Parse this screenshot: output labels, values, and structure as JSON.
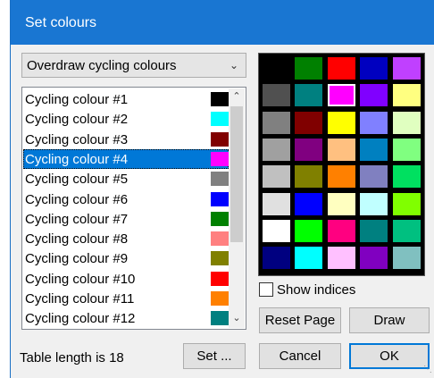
{
  "window": {
    "title": "Set colours"
  },
  "dropdown": {
    "value": "Overdraw cycling colours"
  },
  "list": {
    "items": [
      {
        "label": "Cycling colour #1",
        "color": "#000000"
      },
      {
        "label": "Cycling colour #2",
        "color": "#00ffff"
      },
      {
        "label": "Cycling colour #3",
        "color": "#800000"
      },
      {
        "label": "Cycling colour #4",
        "color": "#ff00ff",
        "selected": true
      },
      {
        "label": "Cycling colour #5",
        "color": "#808080"
      },
      {
        "label": "Cycling colour #6",
        "color": "#0000ff"
      },
      {
        "label": "Cycling colour #7",
        "color": "#008000"
      },
      {
        "label": "Cycling colour #8",
        "color": "#ff8080"
      },
      {
        "label": "Cycling colour #9",
        "color": "#808000"
      },
      {
        "label": "Cycling colour #10",
        "color": "#ff0000"
      },
      {
        "label": "Cycling colour #11",
        "color": "#ff8000"
      },
      {
        "label": "Cycling colour #12",
        "color": "#008080"
      }
    ]
  },
  "palette": {
    "rows": [
      [
        "#000000",
        "#008000",
        "#ff0000",
        "#0000c0",
        "#c040ff"
      ],
      [
        "#505050",
        "#008080",
        "#ff00ff",
        "#8000ff",
        "#ffff80"
      ],
      [
        "#808080",
        "#800000",
        "#ffff00",
        "#8080ff",
        "#e0ffc0"
      ],
      [
        "#a0a0a0",
        "#800080",
        "#ffc080",
        "#0080c0",
        "#80ff80"
      ],
      [
        "#c0c0c0",
        "#808000",
        "#ff8000",
        "#8080c0",
        "#00e060"
      ],
      [
        "#e0e0e0",
        "#0000ff",
        "#ffffc0",
        "#c0ffff",
        "#80ff00"
      ],
      [
        "#ffffff",
        "#00ff00",
        "#ff0080",
        "#008080",
        "#00c080"
      ],
      [
        "#000080",
        "#00ffff",
        "#ffc0ff",
        "#8000c0",
        "#80c0c0"
      ]
    ],
    "selected": [
      1,
      2
    ]
  },
  "show_indices": {
    "label": "Show indices",
    "checked": false
  },
  "buttons": {
    "reset_page": "Reset Page",
    "draw": "Draw",
    "set": "Set ...",
    "cancel": "Cancel",
    "ok": "OK"
  },
  "status": {
    "text": "Table length is 18"
  },
  "icons": {
    "dropdown": "chevron-down-icon",
    "scroll_up": "chevron-up-icon",
    "scroll_down": "chevron-down-icon",
    "resize": "resize-grip-icon"
  }
}
